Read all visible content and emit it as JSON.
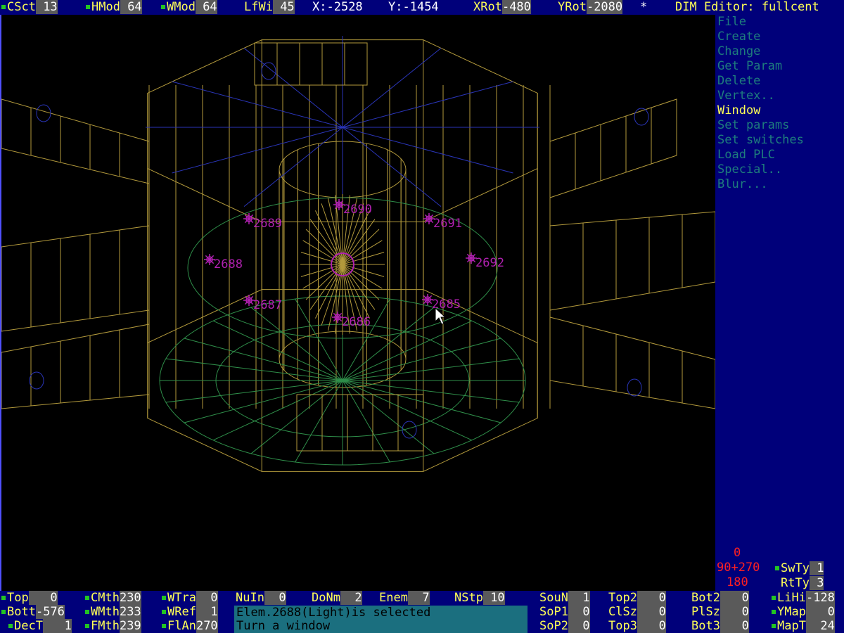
{
  "top_bar": {
    "csct_label": "CSct",
    "csct_value": " 13",
    "hmod_label": "HMod",
    "hmod_value": " 64",
    "wmod_label": "WMod",
    "wmod_value": " 64",
    "lfwi_label": "LfWi",
    "lfwi_value": " 45",
    "x_label": "X:",
    "x_value": "-2528",
    "y_label": "Y:",
    "y_value": "-1454",
    "xrot_label": "XRot",
    "xrot_value": "-480",
    "yrot_label": "YRot",
    "yrot_value": "-2080",
    "star": "*",
    "editor_title": "DIM Editor: fullcent"
  },
  "menu": {
    "items": [
      "File",
      "Create",
      "Change",
      "Get Param",
      "Delete",
      "Vertex..",
      "Window",
      "Set params",
      "Set switches",
      "Load PLC",
      "Special..",
      "Blur..."
    ],
    "active_index": 6
  },
  "angles": {
    "top": "0",
    "middle": "90+270",
    "bottom": "180"
  },
  "switches": {
    "swty_label": "SwTy",
    "swty_value": " 1",
    "rtty_label": "RtTy",
    "rtty_value": " 3"
  },
  "lights": [
    "2690",
    "2689",
    "2691",
    "2688",
    "2692",
    "2687",
    "2685",
    "2686"
  ],
  "bottom": {
    "row1": {
      "top_label": "Top",
      "top_value": "   0",
      "cmth_label": "CMth",
      "cmth_value": "230",
      "wtra_label": "WTra",
      "wtra_value": "  0",
      "nuin_label": "NuIn",
      "nuin_value": "  0",
      "donm_label": "DoNm",
      "donm_value": "  2",
      "enem_label": "Enem",
      "enem_value": "  7",
      "nstp_label": "NStp",
      "nstp_value": " 10",
      "soun_label": "SouN",
      "soun_value": "  1",
      "top2_label": "Top2",
      "top2_value": "   0",
      "bot2_label": "Bot2",
      "bot2_value": "   0",
      "lihi_label": "LiHi",
      "lihi_value": "-128"
    },
    "row2": {
      "bott_label": "Bott",
      "bott_value": "-576",
      "wmth_label": "WMth",
      "wmth_value": "233",
      "wref_label": "WRef",
      "wref_value": "  1",
      "sop1_label": "SoP1",
      "sop1_value": "  0",
      "clsz_label": "ClSz",
      "clsz_value": "   0",
      "plsz_label": "PlSz",
      "plsz_value": "   0",
      "ymap_label": "YMap",
      "ymap_value": "   0"
    },
    "row3": {
      "dect_label": "DecT",
      "dect_value": "   1",
      "fmth_label": "FMth",
      "fmth_value": "239",
      "flan_label": "FlAn",
      "flan_value": "270",
      "sop2_label": "SoP2",
      "sop2_value": "  0",
      "top3_label": "Top3",
      "top3_value": "   0",
      "bot3_label": "Bot3",
      "bot3_value": "   0",
      "mapt_label": "MapT",
      "mapt_value": "  24"
    },
    "messages": [
      "Elem.2688(Light)is selected",
      "Turn a window"
    ]
  },
  "colors": {
    "wire": "#b39a3c",
    "blue": "#2a35b8",
    "green": "#2f8f4a",
    "light": "#b021b0",
    "background": "#000000",
    "panel": "#00007a"
  }
}
